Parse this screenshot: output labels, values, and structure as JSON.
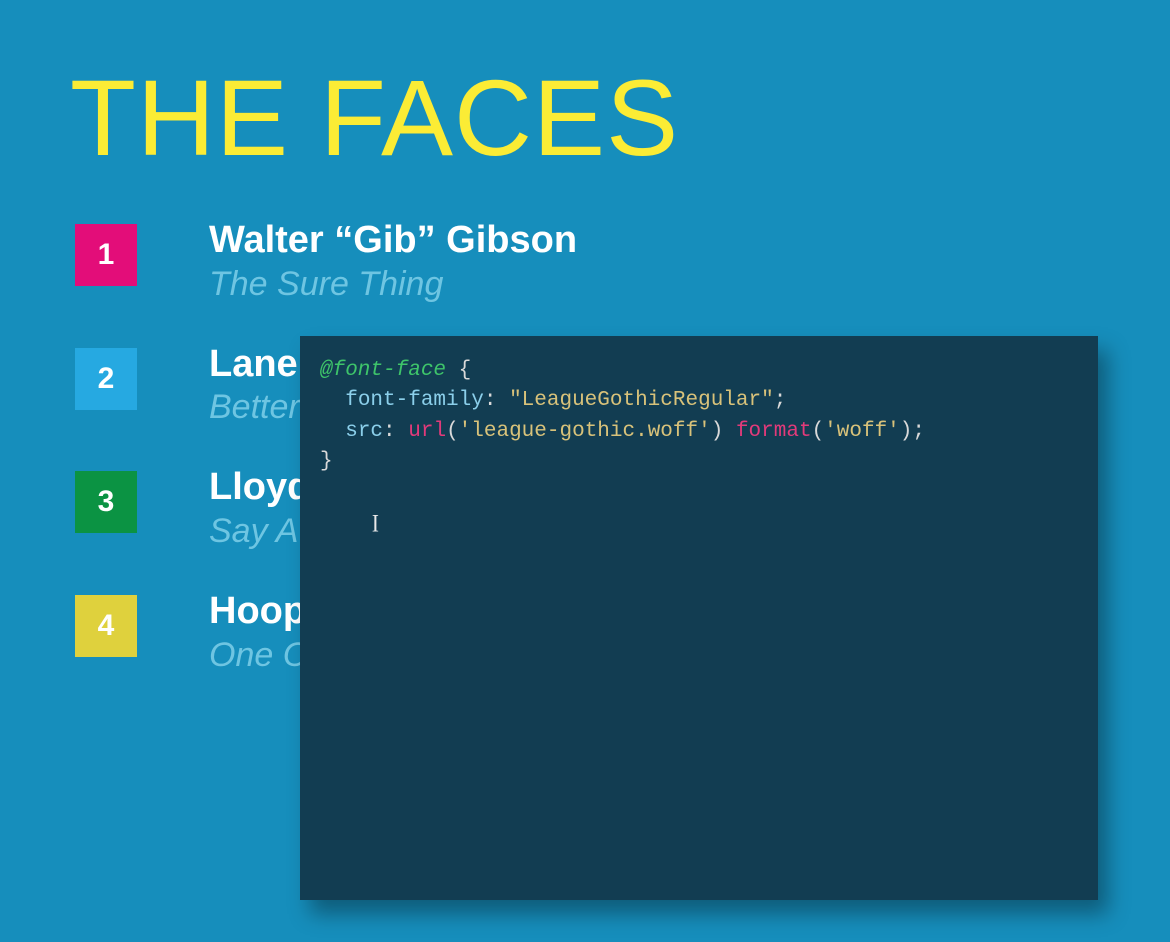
{
  "title": "THE FACES",
  "items": [
    {
      "num": "1",
      "name": "Walter “Gib” Gibson",
      "sub": "The Sure Thing"
    },
    {
      "num": "2",
      "name": "Lane",
      "sub": "Better"
    },
    {
      "num": "3",
      "name": "Lloyd",
      "sub": "Say A"
    },
    {
      "num": "4",
      "name": "Hoop",
      "sub": "One C"
    }
  ],
  "code": {
    "at_rule": "@font-face",
    "brace_open": " {",
    "indent": "  ",
    "prop1": "font-family",
    "colon": ": ",
    "val1": "\"LeagueGothicRegular\"",
    "semi": ";",
    "prop2": "src",
    "func_url": "url",
    "paren_open": "(",
    "url_arg": "'league-gothic.woff'",
    "paren_close": ")",
    "space": " ",
    "func_format": "format",
    "format_arg": "'woff'",
    "brace_close": "}",
    "caret_indent": "    ",
    "caret_glyph": "I"
  }
}
